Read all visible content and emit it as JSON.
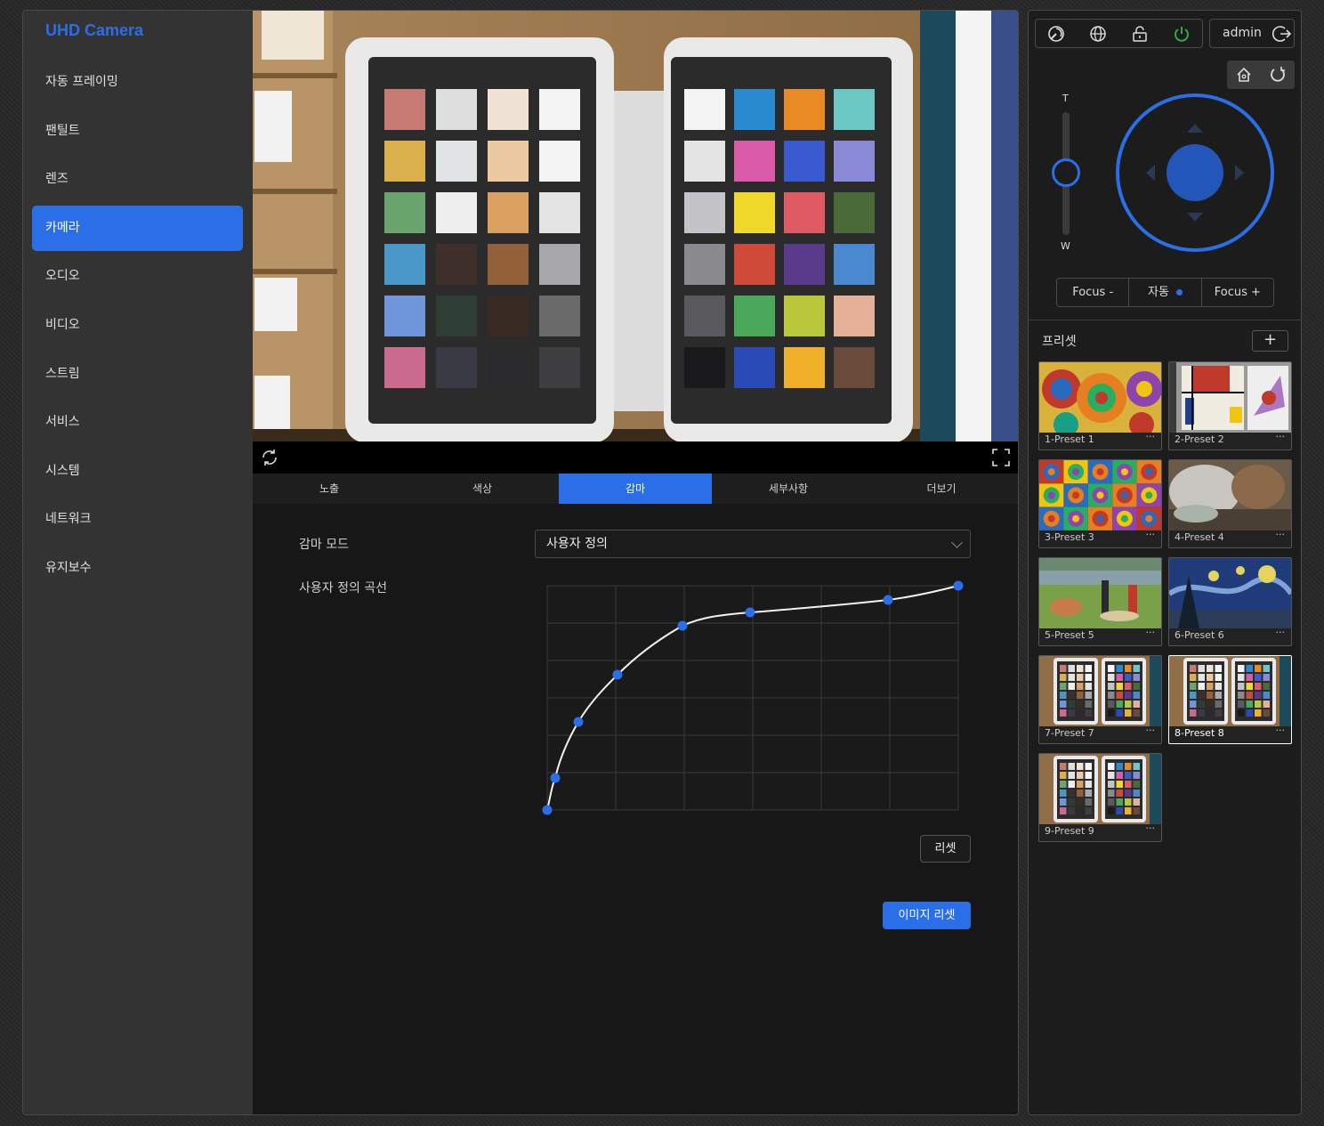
{
  "app": {
    "title": "UHD Camera"
  },
  "sidebar": {
    "items": [
      {
        "label": "자동 프레이밍"
      },
      {
        "label": "팬틸트"
      },
      {
        "label": "렌즈"
      },
      {
        "label": "카메라",
        "active": true
      },
      {
        "label": "오디오"
      },
      {
        "label": "비디오"
      },
      {
        "label": "스트림"
      },
      {
        "label": "서비스"
      },
      {
        "label": "시스템"
      },
      {
        "label": "네트워크"
      },
      {
        "label": "유지보수"
      }
    ]
  },
  "tabs": [
    {
      "label": "노출"
    },
    {
      "label": "색상"
    },
    {
      "label": "감마",
      "active": true
    },
    {
      "label": "세부사항"
    },
    {
      "label": "더보기"
    }
  ],
  "gamma": {
    "mode_label": "감마 모드",
    "mode_value": "사용자 정의",
    "curve_label": "사용자 정의 곡선",
    "reset_label": "리셋",
    "image_reset_label": "이미지 리셋"
  },
  "header": {
    "username": "admin"
  },
  "ptz": {
    "zoom_tele": "T",
    "zoom_wide": "W",
    "focus_minus": "Focus -",
    "focus_auto": "자동",
    "focus_plus": "Focus +"
  },
  "presets": {
    "title": "프리셋",
    "add_label": "+",
    "items": [
      {
        "name": "1-Preset 1",
        "more": "···"
      },
      {
        "name": "2-Preset 2",
        "more": "···"
      },
      {
        "name": "3-Preset 3",
        "more": "···"
      },
      {
        "name": "4-Preset 4",
        "more": "···"
      },
      {
        "name": "5-Preset 5",
        "more": "···"
      },
      {
        "name": "6-Preset 6",
        "more": "···"
      },
      {
        "name": "7-Preset 7",
        "more": "···"
      },
      {
        "name": "8-Preset 8",
        "more": "···",
        "active": true
      },
      {
        "name": "9-Preset 9",
        "more": "···"
      }
    ]
  },
  "colors": {
    "accent": "#2b6fe8",
    "power": "#2bb84a"
  }
}
